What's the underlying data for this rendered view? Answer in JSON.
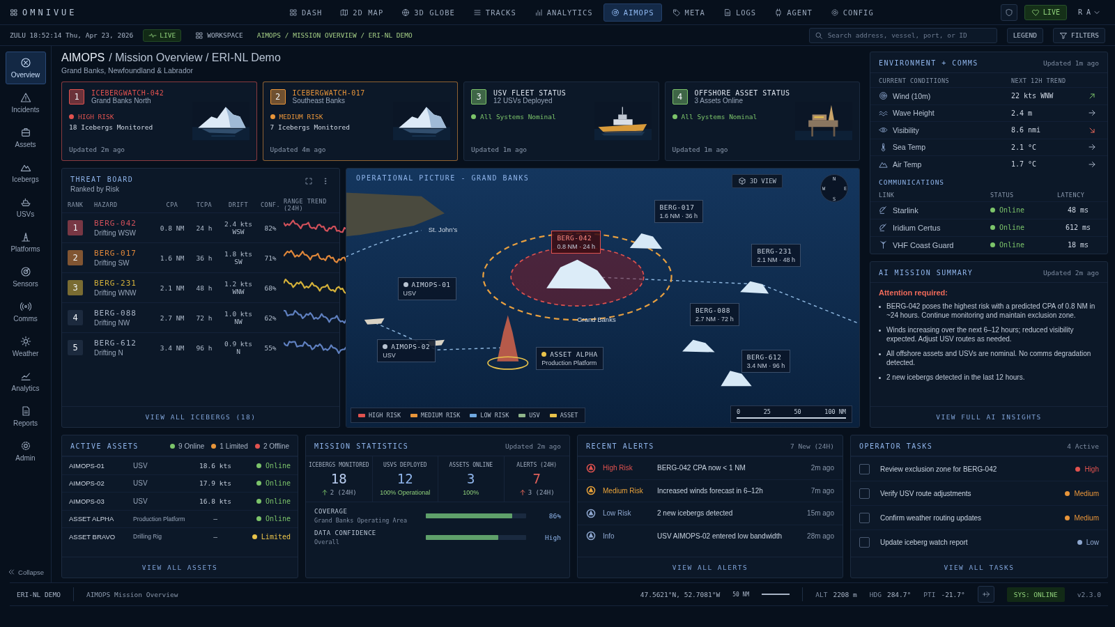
{
  "brand": "OMNIVUE",
  "nav": [
    {
      "label": "DASH",
      "selected": false
    },
    {
      "label": "2D MAP",
      "selected": false
    },
    {
      "label": "3D GLOBE",
      "selected": false
    },
    {
      "label": "TRACKS",
      "selected": false
    },
    {
      "label": "ANALYTICS",
      "selected": false
    },
    {
      "label": "AIMOPS",
      "selected": true
    },
    {
      "label": "META",
      "selected": false
    },
    {
      "label": "LOGS",
      "selected": false
    },
    {
      "label": "AGENT",
      "selected": false
    },
    {
      "label": "CONFIG",
      "selected": false
    }
  ],
  "top_right": {
    "live": "LIVE",
    "user": "R A"
  },
  "subbar": {
    "clock": "ZULU 18:52:14 Thu, Apr 23, 2026",
    "live": "LIVE",
    "workspace": "WORKSPACE",
    "breadcrumb": "AIMOPS / MISSION OVERVIEW / ERI-NL DEMO",
    "search_placeholder": "Search address, vessel, port, or ID",
    "legend": "LEGEND",
    "filters": "FILTERS"
  },
  "sidebar": {
    "items": [
      {
        "label": "Overview",
        "selected": true
      },
      {
        "label": "Incidents",
        "selected": false
      },
      {
        "label": "Assets",
        "selected": false
      },
      {
        "label": "Icebergs",
        "selected": false
      },
      {
        "label": "USVs",
        "selected": false
      },
      {
        "label": "Platforms",
        "selected": false
      },
      {
        "label": "Sensors",
        "selected": false
      },
      {
        "label": "Comms",
        "selected": false
      },
      {
        "label": "Weather",
        "selected": false
      },
      {
        "label": "Analytics",
        "selected": false
      },
      {
        "label": "Reports",
        "selected": false
      },
      {
        "label": "Admin",
        "selected": false
      }
    ],
    "collapse": "Collapse"
  },
  "header": {
    "title": "AIMOPS",
    "path": "/ Mission Overview / ERI-NL Demo",
    "subtitle": "Grand Banks, Newfoundland & Labrador"
  },
  "cards": [
    {
      "kind": "iceberg",
      "rank": "1",
      "title": "ICEBERGWATCH-042",
      "subtitle": "Grand Banks North",
      "status": "HIGH RISK",
      "detail": "18 Icebergs Monitored",
      "updated": "Updated 2m ago",
      "color": "#e0524f"
    },
    {
      "kind": "iceberg",
      "rank": "2",
      "title": "ICEBERGWATCH-017",
      "subtitle": "Southeast Banks",
      "status": "MEDIUM RISK",
      "detail": "7 Icebergs Monitored",
      "updated": "Updated 4m ago",
      "color": "#e8953a"
    },
    {
      "kind": "vessel",
      "rank": "3",
      "title": "USV FLEET STATUS",
      "subtitle": "12 USVs Deployed",
      "status": "All Systems Nominal",
      "updated": "Updated 1m ago",
      "color": "#7cc46a"
    },
    {
      "kind": "platform",
      "rank": "4",
      "title": "OFFSHORE ASSET STATUS",
      "subtitle": "3 Assets Online",
      "status": "All Systems Nominal",
      "updated": "Updated 1m ago",
      "color": "#7cc46a"
    }
  ],
  "threat_board": {
    "title": "THREAT BOARD",
    "subtitle": "Ranked by Risk",
    "columns": [
      "RANK",
      "HAZARD",
      "CPA",
      "TCPA",
      "DRIFT",
      "CONF.",
      "RANGE TREND (24H)"
    ],
    "rows": [
      {
        "rank": "1",
        "name": "BERG-042",
        "heading": "Drifting WSW",
        "cpa": "0.8 NM",
        "tcpa": "24 h",
        "drift": "2.4 kts",
        "drift_dir": "WSW",
        "conf": "82%",
        "highlight": true,
        "color": "#d0505a"
      },
      {
        "rank": "2",
        "name": "BERG-017",
        "heading": "Drifting SW",
        "cpa": "1.6 NM",
        "tcpa": "36 h",
        "drift": "1.8 kts",
        "drift_dir": "SW",
        "conf": "71%",
        "highlight": true,
        "color": "#e0873a"
      },
      {
        "rank": "3",
        "name": "BERG-231",
        "heading": "Drifting WNW",
        "cpa": "2.1 NM",
        "tcpa": "48 h",
        "drift": "1.2 kts",
        "drift_dir": "WNW",
        "conf": "68%",
        "highlight": true,
        "color": "#d4b13a"
      },
      {
        "rank": "4",
        "name": "BERG-088",
        "heading": "Drifting NW",
        "cpa": "2.7 NM",
        "tcpa": "72 h",
        "drift": "1.0 kts",
        "drift_dir": "NW",
        "conf": "62%",
        "highlight": false,
        "color": "#5f80c0"
      },
      {
        "rank": "5",
        "name": "BERG-612",
        "heading": "Drifting N",
        "cpa": "3.4 NM",
        "tcpa": "96 h",
        "drift": "0.9 kts",
        "drift_dir": "N",
        "conf": "55%",
        "highlight": false,
        "color": "#5f80c0"
      }
    ],
    "footer": "VIEW ALL ICEBERGS (18)"
  },
  "map": {
    "title": "OPERATIONAL PICTURE - GRAND BANKS",
    "view_button": "3D VIEW",
    "compass": [
      "N",
      "E",
      "S",
      "W"
    ],
    "places": [
      "St. John's",
      "Grand Banks"
    ],
    "markers": [
      {
        "kind": "iceberg",
        "name": "BERG-017",
        "detail": "1.6 NM · 36 h",
        "selected": false
      },
      {
        "kind": "iceberg",
        "name": "BERG-042",
        "detail": "0.8 NM · 24 h",
        "selected": true
      },
      {
        "kind": "iceberg",
        "name": "BERG-231",
        "detail": "2.1 NM · 48 h",
        "selected": false
      },
      {
        "kind": "iceberg",
        "name": "BERG-088",
        "detail": "2.7 NM · 72 h",
        "selected": false
      },
      {
        "kind": "iceberg",
        "name": "BERG-612",
        "detail": "3.4 NM · 96 h",
        "selected": false
      },
      {
        "kind": "usv",
        "name": "AIMOPS-01",
        "detail": "USV",
        "selected": false
      },
      {
        "kind": "usv",
        "name": "AIMOPS-02",
        "detail": "USV",
        "selected": false
      },
      {
        "kind": "asset",
        "name": "ASSET ALPHA",
        "detail": "Production Platform",
        "selected": false
      }
    ],
    "legend": [
      {
        "label": "HIGH RISK",
        "color": "#e0524f"
      },
      {
        "label": "MEDIUM RISK",
        "color": "#e8953a"
      },
      {
        "label": "LOW RISK",
        "color": "#6fa8e0"
      },
      {
        "label": "USV",
        "color": "#8fb58a"
      },
      {
        "label": "ASSET",
        "color": "#e8c24a"
      }
    ],
    "scale": [
      "0",
      "25",
      "50",
      "100 NM"
    ]
  },
  "environment": {
    "title": "ENVIRONMENT + COMMS",
    "updated": "Updated 1m ago",
    "headers": [
      "CURRENT CONDITIONS",
      "NEXT 12H TREND"
    ],
    "conditions": [
      {
        "label": "Wind (10m)",
        "value": "22 kts WNW",
        "kind": "up"
      },
      {
        "label": "Wave Height",
        "value": "2.4 m",
        "kind": "flat"
      },
      {
        "label": "Visibility",
        "value": "8.6 nmi",
        "kind": "down"
      },
      {
        "label": "Sea Temp",
        "value": "2.1 °C",
        "kind": "flat"
      },
      {
        "label": "Air Temp",
        "value": "1.7 °C",
        "kind": "flat"
      }
    ],
    "comms_title": "COMMUNICATIONS",
    "comms_columns": [
      "LINK",
      "STATUS",
      "LATENCY"
    ],
    "links": [
      {
        "name": "Starlink",
        "status": "Online",
        "latency": "48 ms",
        "color": "#7cc46a"
      },
      {
        "name": "Iridium Certus",
        "status": "Online",
        "latency": "612 ms",
        "color": "#7cc46a"
      },
      {
        "name": "VHF Coast Guard",
        "status": "Online",
        "latency": "18 ms",
        "color": "#7cc46a"
      }
    ]
  },
  "ai_summary": {
    "title": "AI MISSION SUMMARY",
    "updated": "Updated 2m ago",
    "attention": "Attention required:",
    "bullets": [
      "BERG-042 poses the highest risk with a predicted CPA of 0.8 NM in ~24 hours. Continue monitoring and maintain exclusion zone.",
      "Winds increasing over the next 6–12 hours; reduced visibility expected. Adjust USV routes as needed.",
      "All offshore assets and USVs are nominal. No comms degradation detected.",
      "2 new icebergs detected in the last 12 hours."
    ],
    "link": "VIEW FULL AI INSIGHTS"
  },
  "active_assets": {
    "title": "ACTIVE ASSETS",
    "counts": [
      {
        "label": "9 Online",
        "color": "#7cc46a"
      },
      {
        "label": "1 Limited",
        "color": "#e8953a"
      },
      {
        "label": "2 Offline",
        "color": "#e0524f"
      }
    ],
    "rows": [
      {
        "name": "AIMOPS-01",
        "type": "USV",
        "speed": "18.6 kts",
        "status": "Online",
        "color": "#7cc46a"
      },
      {
        "name": "AIMOPS-02",
        "type": "USV",
        "speed": "17.9 kts",
        "status": "Online",
        "color": "#7cc46a"
      },
      {
        "name": "AIMOPS-03",
        "type": "USV",
        "speed": "16.8 kts",
        "status": "Online",
        "color": "#7cc46a"
      },
      {
        "name": "ASSET ALPHA",
        "type": "Production Platform",
        "speed": "—",
        "status": "Online",
        "color": "#7cc46a"
      },
      {
        "name": "ASSET BRAVO",
        "type": "Drilling Rig",
        "speed": "—",
        "status": "Limited",
        "color": "#e8c24a"
      }
    ],
    "footer": "VIEW ALL ASSETS"
  },
  "mission_stats": {
    "title": "MISSION STATISTICS",
    "updated": "Updated 2m ago",
    "stats": [
      {
        "label": "ICEBERGS MONITORED",
        "value": "18",
        "sub": "2 (24H)",
        "kind": "rise",
        "color": "#b9cdf0"
      },
      {
        "label": "USVS DEPLOYED",
        "value": "12",
        "sub": "100% Operational",
        "kind": "good",
        "color": "#8fb4ea"
      },
      {
        "label": "ASSETS ONLINE",
        "value": "3",
        "sub": "100%",
        "kind": "good",
        "color": "#8fb4ea"
      },
      {
        "label": "ALERTS (24H)",
        "value": "7",
        "sub": "3 (24H)",
        "kind": "alarm",
        "color": "#e0605a"
      }
    ],
    "bars": [
      {
        "label": "COVERAGE",
        "sub": "Grand Banks Operating Area",
        "level": 0.86,
        "reading": "86%"
      },
      {
        "label": "DATA CONFIDENCE",
        "sub": "Overall",
        "level": 0.72,
        "reading": "High"
      }
    ]
  },
  "alerts": {
    "title": "RECENT ALERTS",
    "count": "7 New (24H)",
    "items": [
      {
        "level": "High Risk",
        "text": "BERG-042 CPA now < 1 NM",
        "time": "2m ago",
        "color": "#e0524f"
      },
      {
        "level": "Medium Risk",
        "text": "Increased winds forecast in 6–12h",
        "time": "7m ago",
        "color": "#e8a23a"
      },
      {
        "level": "Low Risk",
        "text": "2 new icebergs detected",
        "time": "15m ago",
        "color": "#8fa8d0"
      },
      {
        "level": "Info",
        "text": "USV AIMOPS-02 entered low bandwidth",
        "time": "28m ago",
        "color": "#8fa8d0"
      }
    ],
    "footer": "VIEW ALL ALERTS"
  },
  "tasks": {
    "title": "OPERATOR TASKS",
    "count": "4 Active",
    "items": [
      {
        "text": "Review exclusion zone for BERG-042",
        "priority": "High",
        "color": "#e0524f",
        "checked": false
      },
      {
        "text": "Verify USV route adjustments",
        "priority": "Medium",
        "color": "#e8953a",
        "checked": false
      },
      {
        "text": "Confirm weather routing updates",
        "priority": "Medium",
        "color": "#e8953a",
        "checked": false
      },
      {
        "text": "Update iceberg watch report",
        "priority": "Low",
        "color": "#8fa8d0",
        "checked": false
      }
    ],
    "footer": "VIEW ALL TASKS"
  },
  "status_bar": {
    "workspace": "ERI-NL DEMO",
    "view": "AIMOPS Mission Overview",
    "coords": "47.5621°N, 52.7081°W",
    "scale": "50 NM",
    "alt_label": "ALT",
    "alt": "2208 m",
    "hdg_label": "HDG",
    "hdg": "284.7°",
    "pti_label": "PTI",
    "pti": "-21.7°",
    "sys": "SYS: ONLINE",
    "version": "v2.3.0"
  }
}
